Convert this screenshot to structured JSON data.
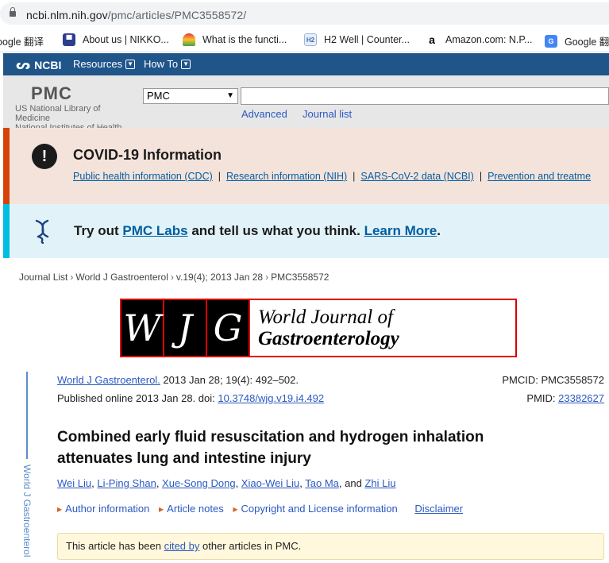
{
  "browser": {
    "url_host": "ncbi.nlm.nih.gov",
    "url_path": "/pmc/articles/PMC3558572/",
    "bookmarks": [
      {
        "label": "oogle 翻译",
        "icon": "google-translate-icon"
      },
      {
        "label": "About us | NIKKO...",
        "icon": "nikko-icon"
      },
      {
        "label": "What is the functi...",
        "icon": "rainbow-icon"
      },
      {
        "label": "H2 Well | Counter...",
        "icon": "h2well-icon"
      },
      {
        "label": "Amazon.com: N.P...",
        "icon": "amazon-icon"
      },
      {
        "label": "Google 翻",
        "icon": "google-translate-icon"
      }
    ]
  },
  "ncbi": {
    "logo": "NCBI",
    "menu": [
      {
        "label": "Resources"
      },
      {
        "label": "How To"
      }
    ]
  },
  "pmc": {
    "logo": "PMC",
    "nlm_lines": [
      "US National Library of",
      "Medicine",
      "National Institutes of Health"
    ],
    "db_selected": "PMC",
    "advanced": "Advanced",
    "journal_list": "Journal list"
  },
  "covid": {
    "title": "COVID-19 Information",
    "links": [
      "Public health information (CDC)",
      "Research information (NIH)",
      "SARS-CoV-2 data (NCBI)",
      "Prevention and treatme"
    ],
    "separator": "|"
  },
  "labs": {
    "prefix": "Try out ",
    "labs_link": "PMC Labs",
    "middle": " and tell us what you think. ",
    "learn_more": "Learn More",
    "suffix": "."
  },
  "breadcrumb": {
    "items": [
      "Journal List",
      "World J Gastroenterol",
      "v.19(4); 2013 Jan 28",
      "PMC3558572"
    ],
    "separator": "›"
  },
  "journal_banner": {
    "letters": [
      "W",
      "J",
      "G"
    ],
    "line1": "World Journal of",
    "line2": "Gastroenterology"
  },
  "sidebar_label": "World J Gastroenterol",
  "citation": {
    "journal_link": "World J Gastroenterol.",
    "details": " 2013 Jan 28; 19(4): 492–502.",
    "published": "Published online 2013 Jan 28. doi: ",
    "doi": "10.3748/wjg.v19.i4.492",
    "pmcid_label": "PMCID: ",
    "pmcid": "PMC3558572",
    "pmid_label": "PMID: ",
    "pmid": "23382627"
  },
  "article": {
    "title_line1": "Combined early fluid resuscitation and hydrogen inhalation",
    "title_line2": "attenuates lung and intestine injury",
    "authors": [
      "Wei Liu",
      "Li-Ping Shan",
      "Xue-Song Dong",
      "Xiao-Wei Liu",
      "Tao Ma",
      "Zhi Liu"
    ],
    "author_sep": ", ",
    "author_and": ", and "
  },
  "info_links": [
    "Author information",
    "Article notes",
    "Copyright and License information"
  ],
  "disclaimer": "Disclaimer",
  "cited": {
    "prefix": "This article has been ",
    "link": "cited by",
    "suffix": " other articles in PMC."
  },
  "colors": {
    "ncbi_blue": "#20558a",
    "covid_accent": "#d54309",
    "labs_accent": "#00bde3",
    "link": "#2b59c3",
    "wjg_red": "#e00000"
  }
}
